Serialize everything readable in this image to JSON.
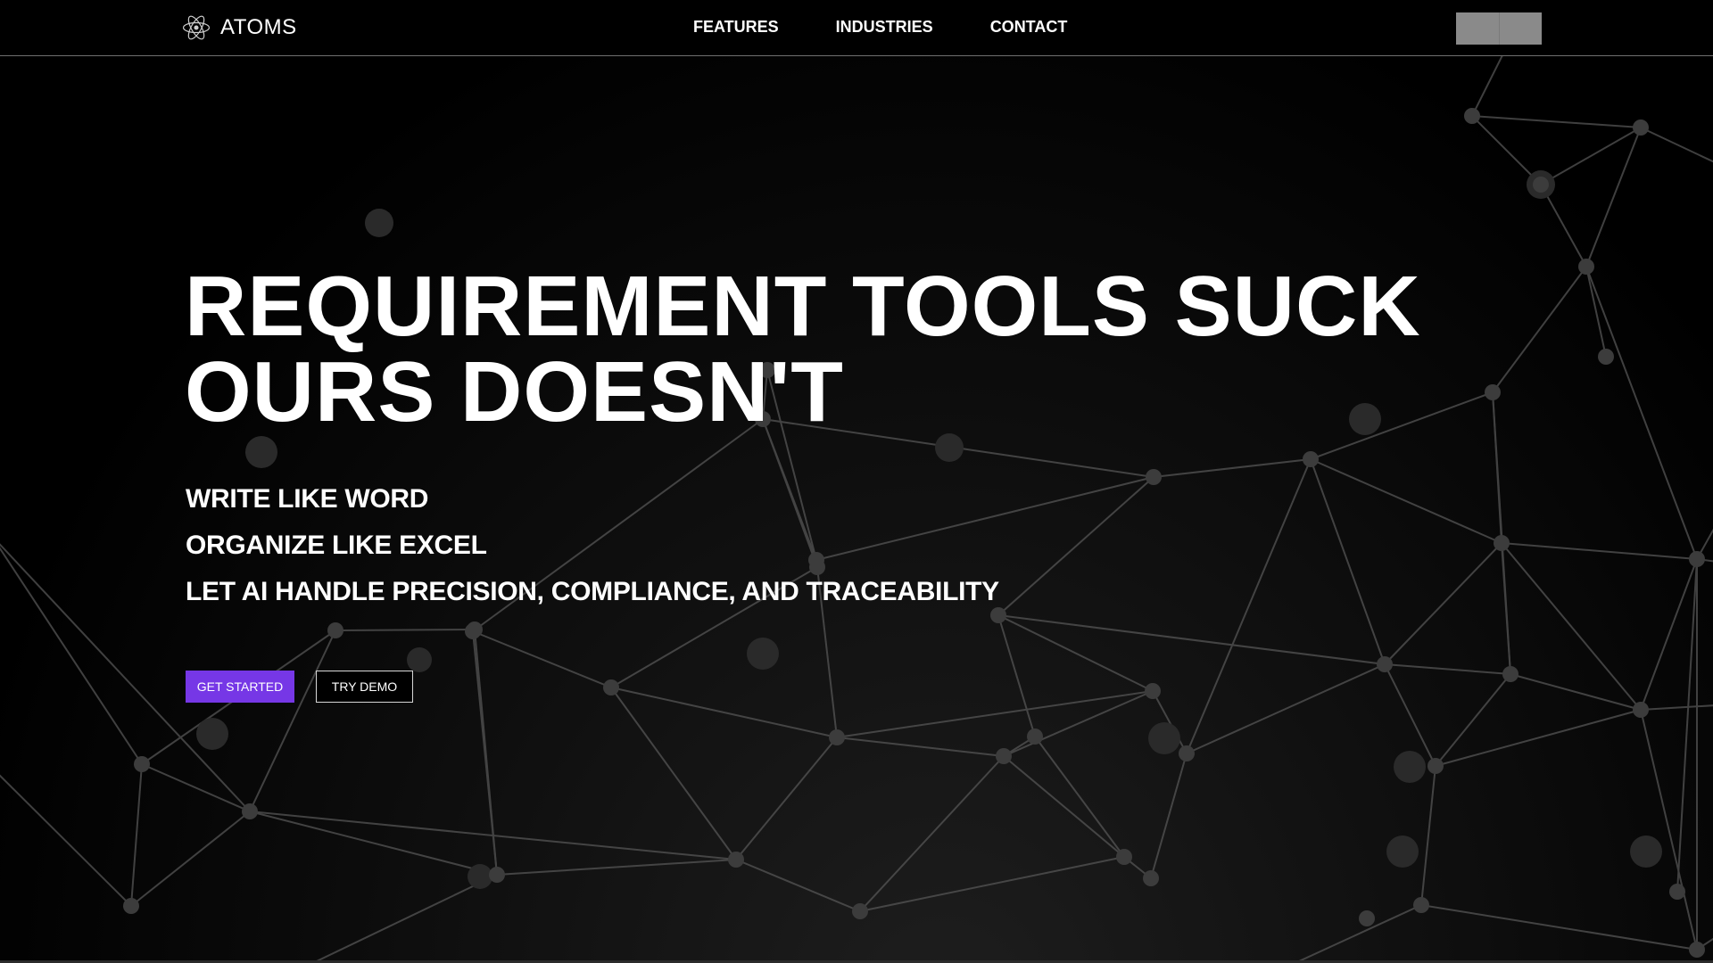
{
  "nav": {
    "logo_icon": "atom-icon",
    "brand": "ATOMS",
    "links": [
      "FEATURES",
      "INDUSTRIES",
      "CONTACT"
    ]
  },
  "hero": {
    "title_line1": "REQUIREMENT TOOLS SUCK",
    "title_line2": "OURS DOESN'T",
    "taglines": [
      "WRITE LIKE WORD",
      "ORGANIZE LIKE EXCEL",
      "LET AI HANDLE PRECISION, COMPLIANCE, AND TRACEABILITY"
    ],
    "primary_cta": "GET STARTED",
    "secondary_cta": "TRY DEMO"
  },
  "colors": {
    "background": "#000000",
    "accent": "#7637e6",
    "network_lines": "#5a5a5a"
  }
}
